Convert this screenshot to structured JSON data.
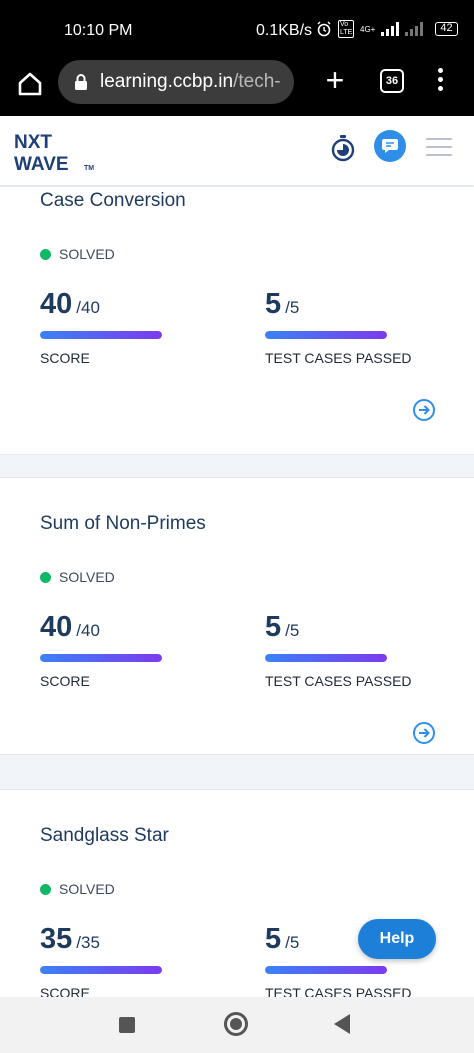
{
  "status_bar": {
    "time": "10:10 PM",
    "data_rate": "0.1KB/s",
    "network": "4G+",
    "volte": "Vo LTE",
    "battery": "42"
  },
  "browser": {
    "url_host": "learning.ccbp.in",
    "url_rest": "/tech-",
    "tab_count": "36",
    "new_tab_symbol": "+",
    "icons": [
      "home-icon",
      "lock-icon",
      "plus-icon",
      "tabs-icon",
      "more-vert-icon"
    ]
  },
  "app_header": {
    "logo_line1": "NXT",
    "logo_line2": "WAVE",
    "logo_tm": "TM",
    "icons": [
      "stopwatch-icon",
      "chat-icon",
      "menu-icon"
    ],
    "colors": {
      "chat_button": "#2f8fe8",
      "logo": "#1f3f7a"
    }
  },
  "questions": [
    {
      "title": "Case Conversion",
      "status": "SOLVED",
      "score": "40",
      "score_total": "/40",
      "score_label": "SCORE",
      "score_progress": 1.0,
      "tests": "5",
      "tests_total": "/5",
      "tests_label": "TEST CASES PASSED",
      "tests_progress": 1.0
    },
    {
      "title": "Sum of Non-Primes",
      "status": "SOLVED",
      "score": "40",
      "score_total": "/40",
      "score_label": "SCORE",
      "score_progress": 1.0,
      "tests": "5",
      "tests_total": "/5",
      "tests_label": "TEST CASES PASSED",
      "tests_progress": 1.0
    },
    {
      "title": "Sandglass Star",
      "status": "SOLVED",
      "score": "35",
      "score_total": "/35",
      "score_label": "SCORE",
      "score_progress": 1.0,
      "tests": "5",
      "tests_total": "/5",
      "tests_label": "TEST CASES PASSED",
      "tests_progress": 1.0
    }
  ],
  "colors": {
    "solved": "#12b76a",
    "progress_start": "#3b82f6",
    "progress_end": "#7c3aed",
    "help_button": "#1d7fd8"
  },
  "help_button": {
    "label": "Help"
  },
  "nav_bar": {
    "icons": [
      "recents-icon",
      "home-circle-icon",
      "back-icon"
    ]
  }
}
